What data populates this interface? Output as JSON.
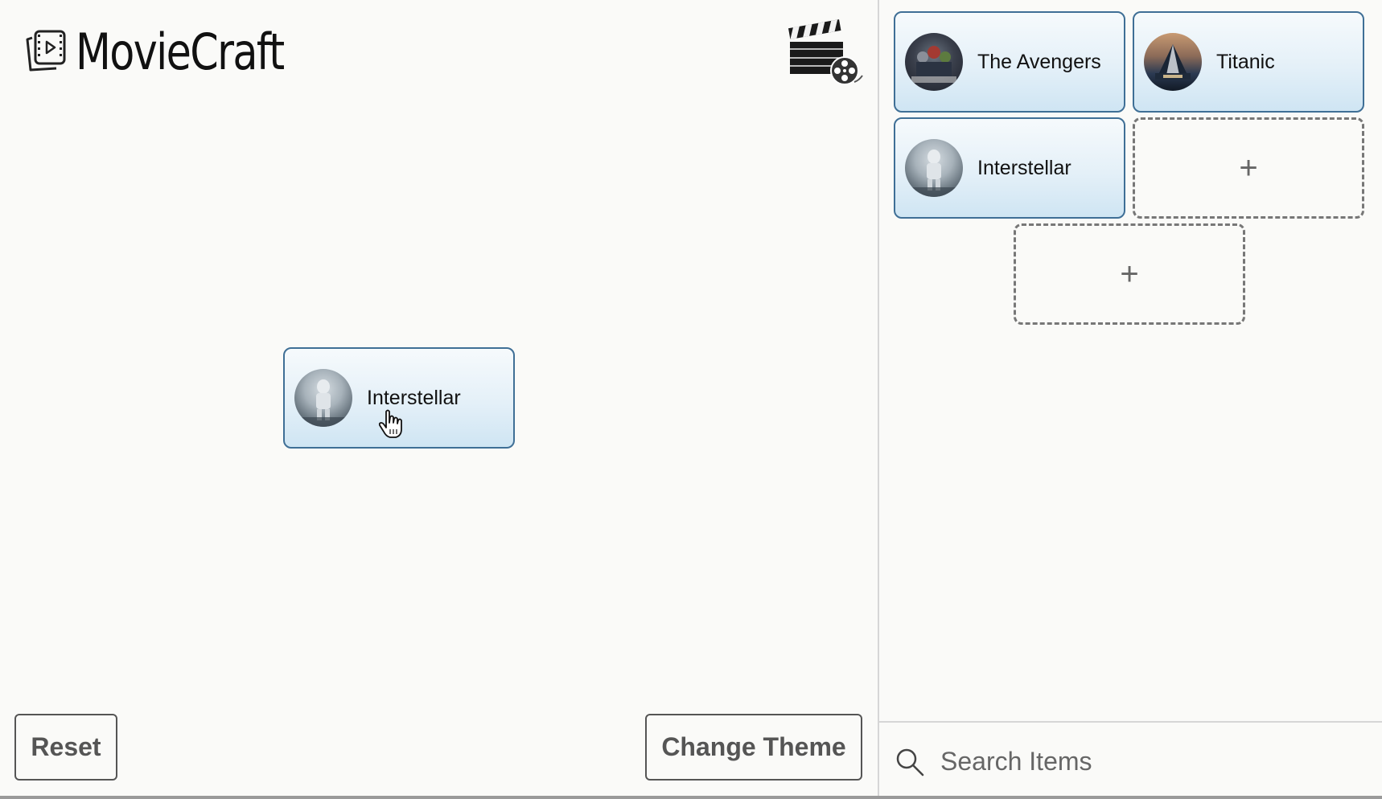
{
  "app": {
    "title": "MovieCraft"
  },
  "workspace": {
    "card": {
      "label": "Interstellar"
    },
    "buttons": {
      "reset_label": "Reset",
      "theme_label": "Change Theme"
    }
  },
  "sidebar": {
    "items": [
      {
        "label": "The Avengers"
      },
      {
        "label": "Titanic"
      },
      {
        "label": "Interstellar"
      }
    ],
    "empty_slots": [
      {
        "label": "+"
      },
      {
        "label": "+"
      }
    ],
    "search": {
      "placeholder": "Search Items",
      "value": ""
    }
  },
  "colors": {
    "card_border": "#3f6f96",
    "card_bg": "#e4f0f8",
    "button_border": "#555555",
    "slot_border": "#777777"
  }
}
